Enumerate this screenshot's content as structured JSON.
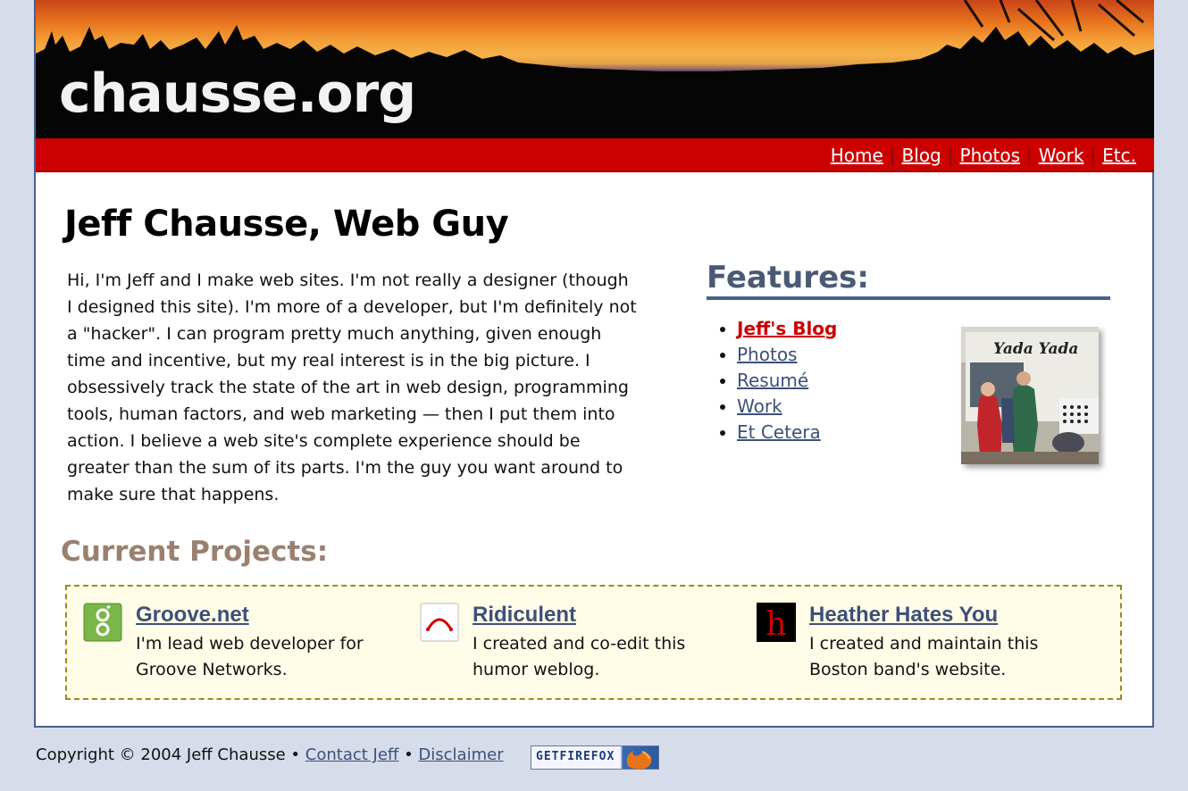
{
  "site": {
    "logo_text": "chausse.org"
  },
  "nav": {
    "items": [
      {
        "label": "Home"
      },
      {
        "label": "Blog"
      },
      {
        "label": "Photos"
      },
      {
        "label": "Work"
      },
      {
        "label": "Etc."
      }
    ],
    "separator": "|"
  },
  "main": {
    "title": "Jeff Chausse, Web Guy",
    "intro": "Hi, I'm Jeff and I make web sites. I'm not really a designer (though I designed this site). I'm more of a developer, but I'm definitely not a \"hacker\". I can program pretty much anything, given enough time and incentive, but my real interest is in the big picture. I obsessively track the state of the art in web design, programming tools, human factors, and web marketing — then I put them into action. I believe a web site's complete experience should be greater than the sum of its parts. I'm the guy you want around to make sure that happens."
  },
  "features": {
    "heading": "Features:",
    "items": [
      {
        "label": "Jeff's Blog"
      },
      {
        "label": "Photos"
      },
      {
        "label": "Resumé"
      },
      {
        "label": "Work"
      },
      {
        "label": "Et Cetera"
      }
    ],
    "photo_sign": "Yada Yada"
  },
  "projects": {
    "heading": "Current Projects:",
    "items": [
      {
        "title": "Groove.net",
        "desc": "I'm lead web developer for Groove Networks.",
        "logo_char": "g",
        "logo_color": "#7ab648"
      },
      {
        "title": "Ridiculent",
        "desc": "I created and co-edit this humor weblog.",
        "logo_char": "⌒",
        "logo_color": "#cc0000"
      },
      {
        "title": "Heather Hates You",
        "desc": "I created and maintain this Boston band's website.",
        "logo_char": "h",
        "logo_color": "#cc0000"
      }
    ]
  },
  "footer": {
    "copyright": "Copyright © 2004 Jeff Chausse",
    "bullet": "•",
    "contact": "Contact Jeff",
    "disclaimer": "Disclaimer",
    "badge": "GETFIREFOX"
  },
  "colors": {
    "nav_red": "#cc0000",
    "link_blue": "#3d5079",
    "background": "#d6dcea",
    "projects_bg": "#fffde8"
  }
}
